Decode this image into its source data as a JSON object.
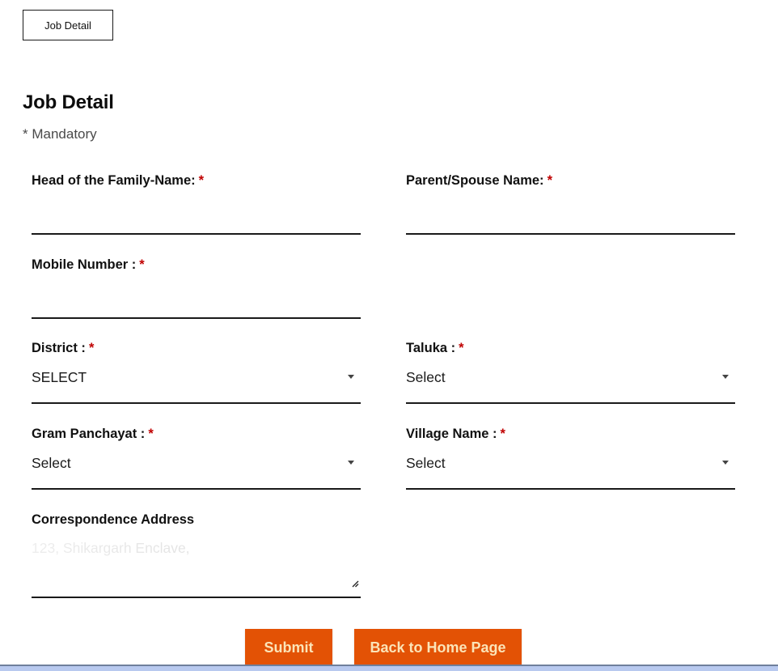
{
  "tab": {
    "label": "Job Detail"
  },
  "page": {
    "title": "Job Detail",
    "mandatory_note": "* Mandatory"
  },
  "form": {
    "required_marker": "*",
    "head_of_family": {
      "label": "Head of the Family-Name:",
      "value": ""
    },
    "parent_spouse": {
      "label": "Parent/Spouse Name:",
      "value": ""
    },
    "mobile": {
      "label": "Mobile Number :",
      "value": ""
    },
    "district": {
      "label": "District :",
      "selected": "SELECT"
    },
    "taluka": {
      "label": "Taluka :",
      "selected": "Select"
    },
    "gram_panchayat": {
      "label": "Gram Panchayat :",
      "selected": "Select"
    },
    "village": {
      "label": "Village Name :",
      "selected": "Select"
    },
    "address": {
      "label": "Correspondence Address",
      "value": "123, Shikargarh Enclave,"
    }
  },
  "buttons": {
    "submit": "Submit",
    "back_home": "Back to Home Page"
  },
  "colors": {
    "accent": "#e35205",
    "button_text": "#fbe4b8",
    "required": "#c00000"
  }
}
